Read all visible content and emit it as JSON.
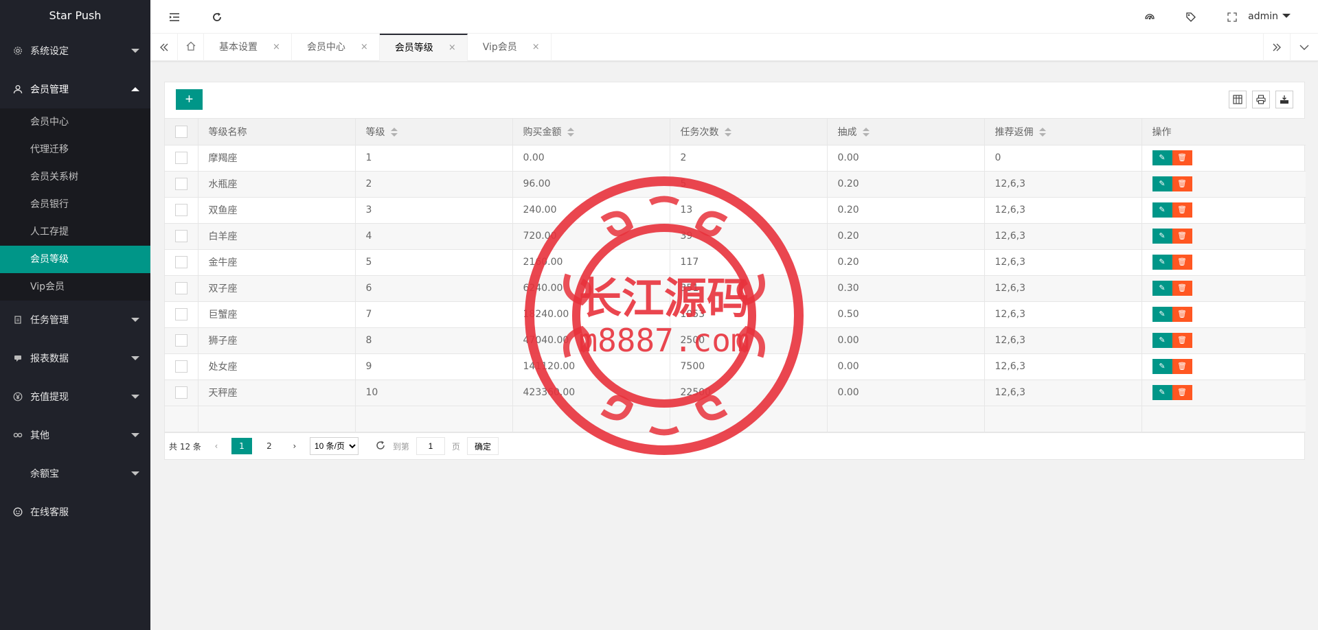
{
  "app": {
    "title": "Star Push"
  },
  "sidebar": {
    "groups": [
      {
        "label": "系统设定",
        "icon": "gear-icon",
        "open": false
      },
      {
        "label": "会员管理",
        "icon": "user-icon",
        "open": true,
        "items": [
          "会员中心",
          "代理迁移",
          "会员关系树",
          "会员银行",
          "人工存提",
          "会员等级",
          "Vip会员"
        ],
        "active_item": "会员等级"
      },
      {
        "label": "任务管理",
        "icon": "document-icon",
        "open": false
      },
      {
        "label": "报表数据",
        "icon": "chat-icon",
        "open": false
      },
      {
        "label": "充值提现",
        "icon": "yen-icon",
        "open": false
      },
      {
        "label": "其他",
        "icon": "link-icon",
        "open": false
      },
      {
        "label": "余额宝",
        "icon": "",
        "open": false
      },
      {
        "label": "在线客服",
        "icon": "smile-icon",
        "open": false
      }
    ]
  },
  "header": {
    "user": "admin",
    "icons": [
      "menu-fold-icon",
      "refresh-icon",
      "theme-icon",
      "tag-icon",
      "fullscreen-icon"
    ]
  },
  "tabs": {
    "items": [
      {
        "label": "基本设置",
        "active": false
      },
      {
        "label": "会员中心",
        "active": false
      },
      {
        "label": "会员等级",
        "active": true
      },
      {
        "label": "Vip会员",
        "active": false
      }
    ],
    "close_glyph": "×"
  },
  "table": {
    "add_label": "+",
    "columns": [
      "等级名称",
      "等级",
      "购买金额",
      "任务次数",
      "抽成",
      "推荐返佣",
      "操作"
    ],
    "rows": [
      [
        "摩羯座",
        "1",
        "0.00",
        "2",
        "0.00",
        "0"
      ],
      [
        "水瓶座",
        "2",
        "96.00",
        "5",
        "0.20",
        "12,6,3"
      ],
      [
        "双鱼座",
        "3",
        "240.00",
        "13",
        "0.20",
        "12,6,3"
      ],
      [
        "白羊座",
        "4",
        "720.00",
        "39",
        "0.20",
        "12,6,3"
      ],
      [
        "金牛座",
        "5",
        "2160.00",
        "117",
        "0.20",
        "12,6,3"
      ],
      [
        "双子座",
        "6",
        "6240.00",
        "351",
        "0.30",
        "12,6,3"
      ],
      [
        "巨蟹座",
        "7",
        "18240.00",
        "1053",
        "0.50",
        "12,6,3"
      ],
      [
        "狮子座",
        "8",
        "47040.00",
        "2500",
        "0.00",
        "12,6,3"
      ],
      [
        "处女座",
        "9",
        "141120.00",
        "7500",
        "0.00",
        "12,6,3"
      ],
      [
        "天秤座",
        "10",
        "423360.00",
        "22500",
        "0.00",
        "12,6,3"
      ]
    ]
  },
  "pager": {
    "total": "共 12 条",
    "pages": [
      "1",
      "2"
    ],
    "current": "1",
    "page_size": "10 条/页",
    "goto_label": "到第",
    "goto_value": "1",
    "page_unit": "页",
    "confirm": "确定"
  },
  "watermark": {
    "line1": "长江源码",
    "line2": "m8887.com",
    "color": "#e8323c"
  }
}
